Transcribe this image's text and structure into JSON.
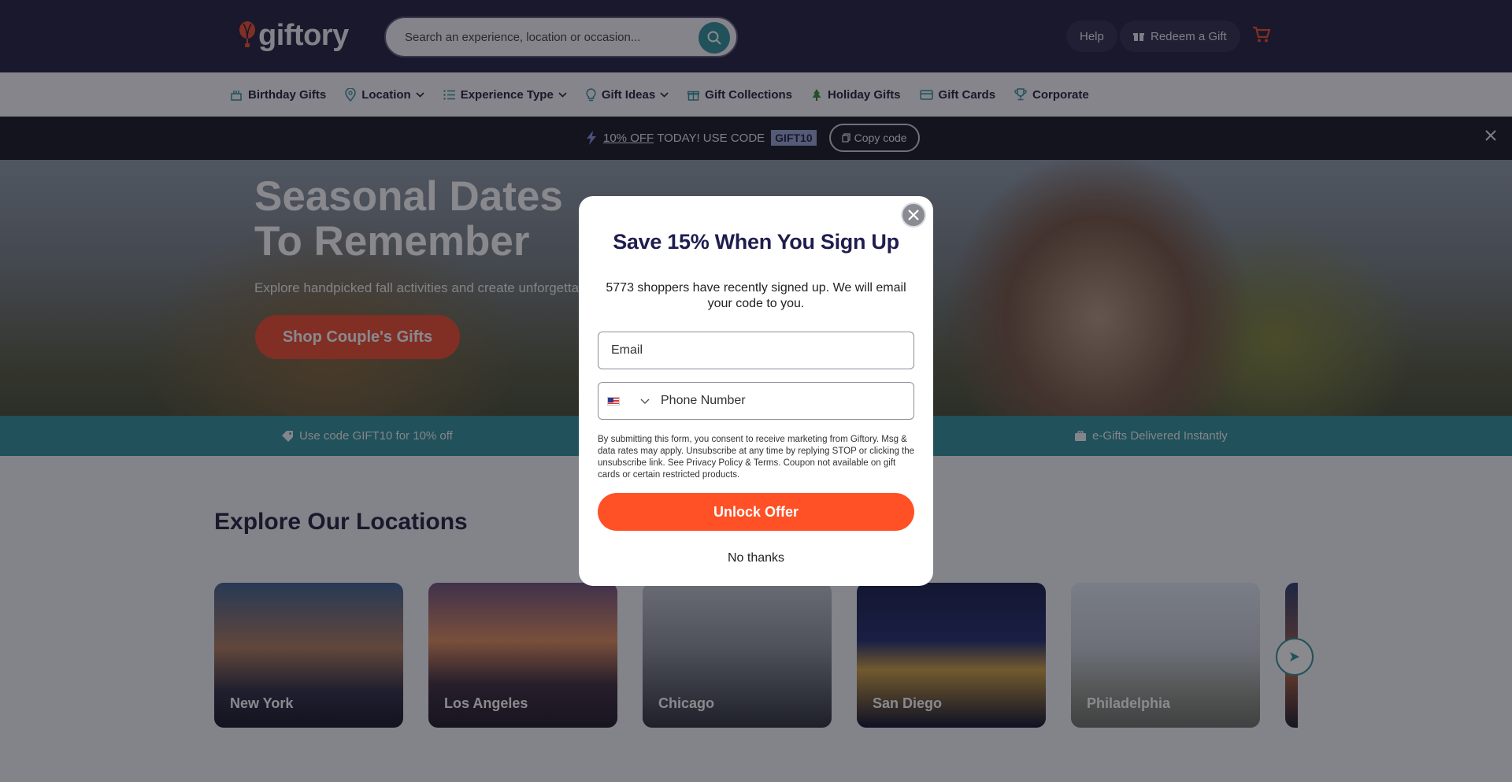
{
  "header": {
    "logo_text": "giftory",
    "search_placeholder": "Search an experience, location or occasion...",
    "help_label": "Help",
    "redeem_label": "Redeem a Gift"
  },
  "nav": {
    "items": [
      {
        "label": "Birthday Gifts",
        "icon": "cake-icon"
      },
      {
        "label": "Location",
        "icon": "location-pin-icon",
        "dropdown": true
      },
      {
        "label": "Experience Type",
        "icon": "list-icon",
        "dropdown": true
      },
      {
        "label": "Gift Ideas",
        "icon": "bulb-icon",
        "dropdown": true
      },
      {
        "label": "Gift Collections",
        "icon": "gift-icon"
      },
      {
        "label": "Holiday Gifts",
        "icon": "tree-icon"
      },
      {
        "label": "Gift Cards",
        "icon": "gift-card-icon"
      },
      {
        "label": "Corporate",
        "icon": "trophy-icon"
      }
    ]
  },
  "promo": {
    "highlight": "10% OFF",
    "text": "TODAY! USE CODE",
    "code": "GIFT10",
    "copy_label": "Copy code"
  },
  "hero": {
    "title_line1": "Seasonal Dates",
    "title_line2": "To Remember",
    "subtitle": "Explore handpicked fall activities and create unforgettable memories",
    "cta": "Shop Couple's Gifts"
  },
  "strip": {
    "left": "Use code GIFT10 for 10% off",
    "right": "e-Gifts Delivered Instantly"
  },
  "locations": {
    "title": "Explore Our Locations",
    "cards": [
      "New York",
      "Los Angeles",
      "Chicago",
      "San Diego",
      "Philadelphia"
    ]
  },
  "modal": {
    "title": "Save 15% When You Sign Up",
    "subtitle": "5773 shoppers have recently signed up. We will email your code to you.",
    "email_placeholder": "Email",
    "phone_placeholder": "Phone Number",
    "legal": "By submitting this form, you consent to receive marketing from Giftory. Msg & data rates may apply. Unsubscribe at any time by replying STOP or clicking the unsubscribe link. See Privacy Policy & Terms. Coupon not available on gift cards or certain restricted products.",
    "unlock_label": "Unlock Offer",
    "no_thanks_label": "No thanks"
  },
  "colors": {
    "header_bg": "#1e1c3a",
    "teal": "#2f8f96",
    "accent": "#ff5026",
    "modal_title": "#1f1d4e"
  }
}
